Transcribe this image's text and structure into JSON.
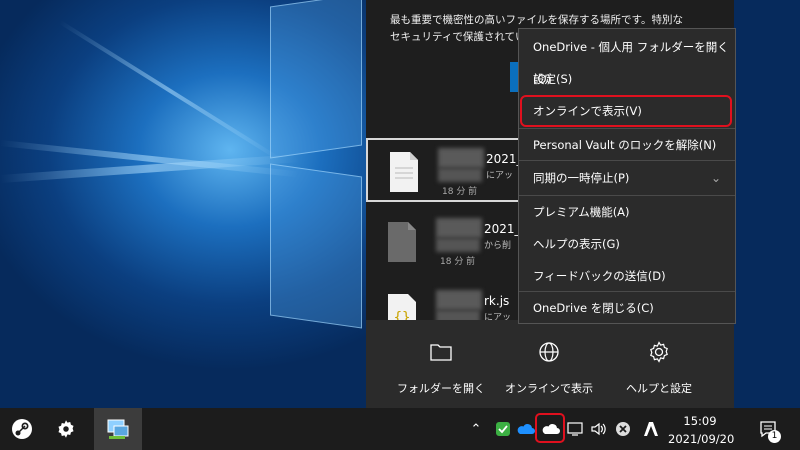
{
  "onedrive_panel": {
    "description": "最も重要で機密性の高いファイルを保存する場所です。特別なセキュリティで保護されていま",
    "files": [
      {
        "name": "2021_",
        "subtitle": "にアッ",
        "time": "18 分 前",
        "icon": "document-icon"
      },
      {
        "name": "2021_",
        "subtitle": "から削",
        "time": "18 分 前",
        "icon": "deleted-document-icon"
      },
      {
        "name": "rk.js",
        "subtitle": "にアッ",
        "time": "18 分 前",
        "icon": "code-file-icon"
      }
    ],
    "bottom_actions": [
      {
        "label": "フォルダーを開く",
        "icon": "folder-icon"
      },
      {
        "label": "オンラインで表示",
        "icon": "globe-icon"
      },
      {
        "label": "ヘルプと設定",
        "icon": "gear-icon"
      }
    ]
  },
  "context_menu": {
    "items": [
      "OneDrive - 個人用 フォルダーを開く(O)",
      "設定(S)",
      "オンラインで表示(V)",
      "Personal Vault のロックを解除(N)",
      "同期の一時停止(P)",
      "プレミアム機能(A)",
      "ヘルプの表示(G)",
      "フィードバックの送信(D)",
      "OneDrive を閉じる(C)"
    ],
    "highlighted_item": "オンラインで表示(V)",
    "highlight_color": "#e0101e"
  },
  "taskbar": {
    "pinned_apps": [
      "steam-icon",
      "settings-icon",
      "network-app-icon"
    ],
    "tray_icons": [
      "chevron-up-icon",
      "security-shield-icon",
      "onedrive-blue-icon",
      "onedrive-white-icon",
      "monitor-icon",
      "volume-icon",
      "close-circle-icon",
      "adobe-icon"
    ],
    "clock_time": "15:09",
    "clock_date": "2021/09/20",
    "notification_count": "1"
  }
}
